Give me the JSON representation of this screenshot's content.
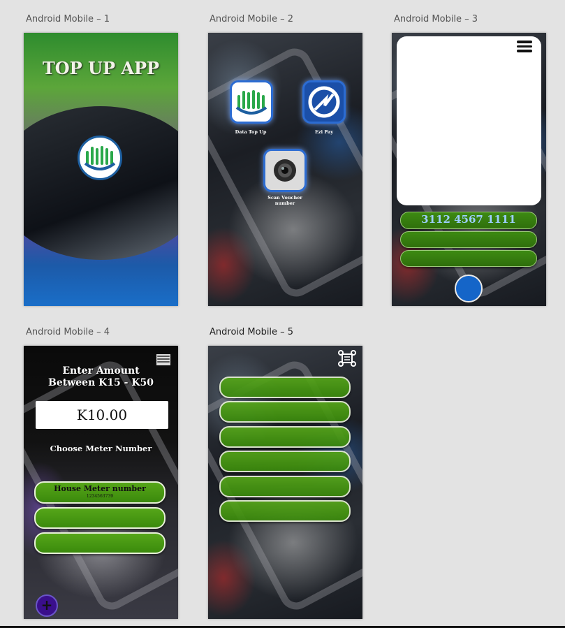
{
  "artboards": [
    {
      "label": "Android Mobile – 1"
    },
    {
      "label": "Android Mobile – 2"
    },
    {
      "label": "Android Mobile – 3"
    },
    {
      "label": "Android Mobile – 4"
    },
    {
      "label": "Android Mobile – 5"
    }
  ],
  "screen1": {
    "title": "TOP UP APP",
    "icons": [
      "logo-icon"
    ]
  },
  "screen2": {
    "apps": [
      {
        "label": "Data Top Up",
        "icon": "logo-icon"
      },
      {
        "label": "Ezi Pay",
        "icon": "pay-icon"
      },
      {
        "label": "Scan Voucher number",
        "icon": "camera-icon"
      }
    ]
  },
  "screen3": {
    "voucher_number": "3112 4567 1111",
    "icons": [
      "menu-icon"
    ]
  },
  "screen4": {
    "heading_line1": "Enter Amount",
    "heading_line2": "Between K15 - K50",
    "amount_value": "K10.00",
    "choose_label": "Choose Meter Number",
    "meter_label": "House Meter number",
    "meter_number": "1234563739",
    "icons": [
      "list-icon",
      "add-icon"
    ]
  },
  "screen5": {
    "icons": [
      "expand-icon"
    ]
  },
  "colors": {
    "pill_green": "#3d8a12",
    "bar_green": "#56a619",
    "button_blue": "#1565c8",
    "fab_purple": "#3a0f8c",
    "icon_blue": "#2c6cd2"
  }
}
